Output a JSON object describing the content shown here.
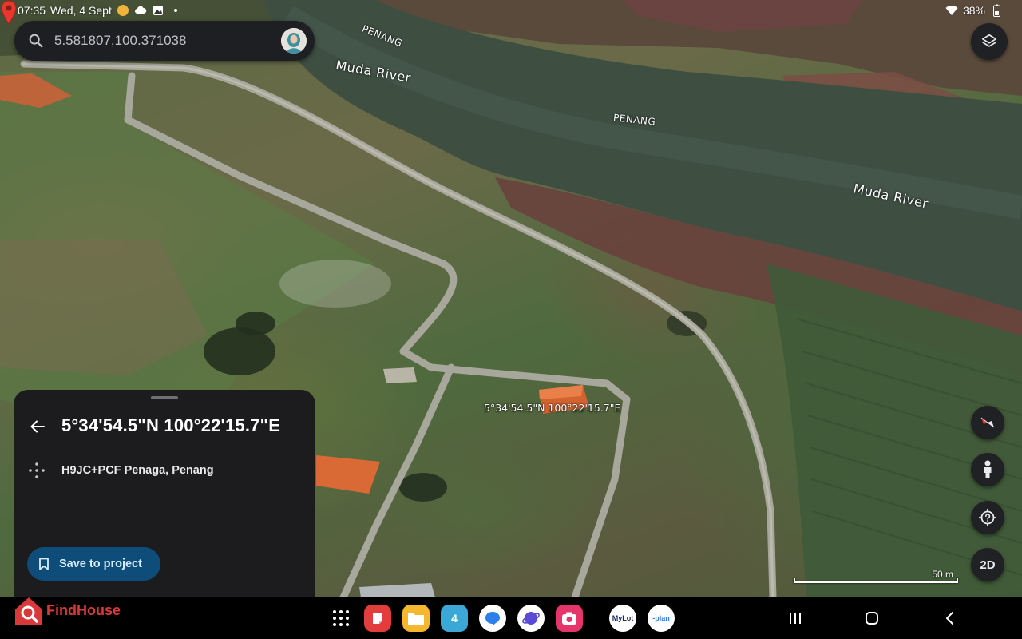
{
  "status_bar": {
    "time": "07:35",
    "date": "Wed, 4 Sept",
    "battery": "38%"
  },
  "search": {
    "value": "5.581807,100.371038"
  },
  "map_labels": {
    "river_1": "Muda River",
    "river_2": "Muda River",
    "state_1": "PENANG",
    "state_2": "PENANG",
    "coord_overlay": "5°34'54.5\"N 100°22'15.7\"E",
    "scale": "50 m"
  },
  "controls": {
    "two_d": "2D"
  },
  "place_panel": {
    "title": "5°34'54.5\"N 100°22'15.7\"E",
    "plus_code": "H9JC+PCF Penaga, Penang",
    "save_label": "Save to project"
  },
  "watermark": {
    "text": "FindHouse"
  },
  "taskbar": {
    "calendar_day": "4",
    "mylot_label": "MyLot",
    "planit_label": "-plan"
  },
  "colors": {
    "panel_bg": "#1c1c1e",
    "save_button_bg": "#0e4d7a",
    "pin": "#e8372f",
    "river": "#3e4f42"
  }
}
